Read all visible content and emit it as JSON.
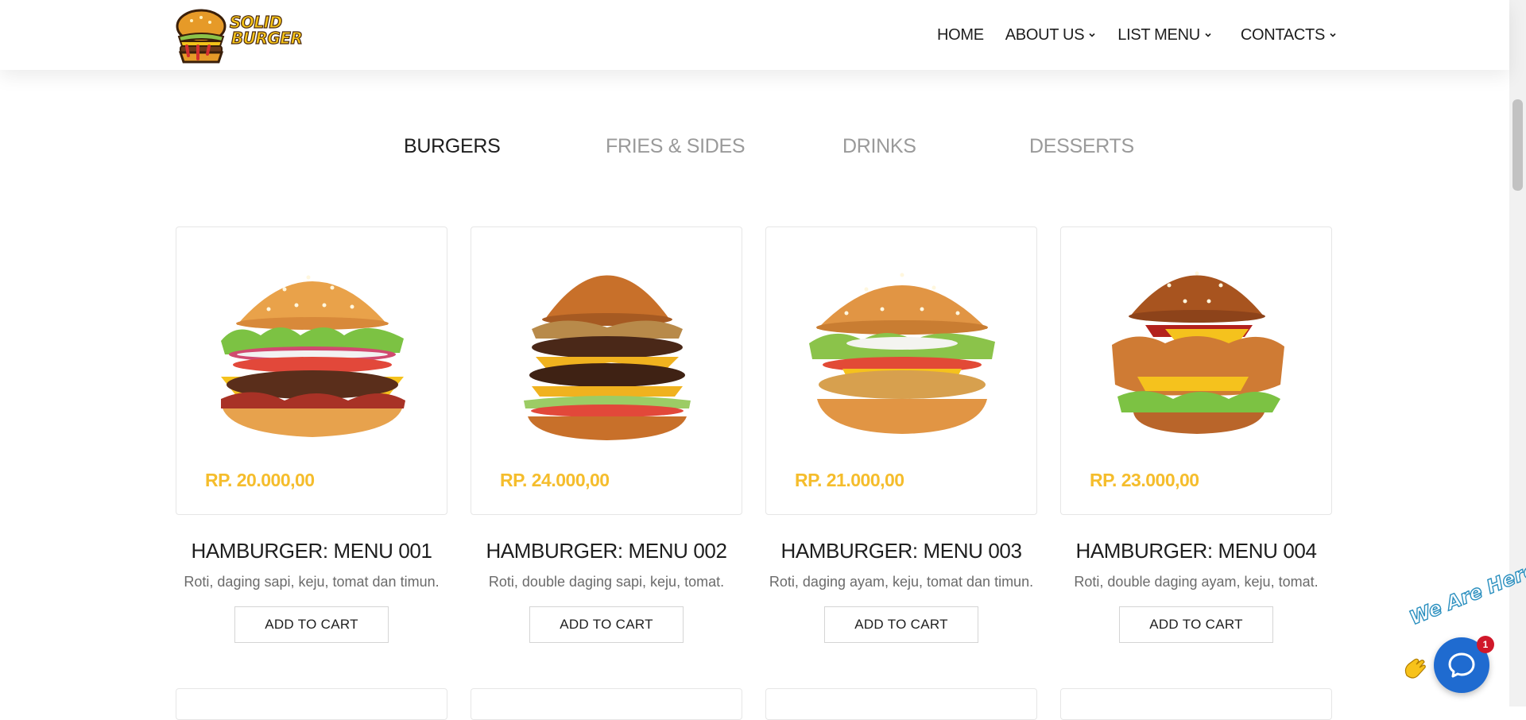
{
  "brand": {
    "line1": "SOLID",
    "line2": "BURGER"
  },
  "nav": {
    "items": [
      {
        "label": "HOME",
        "dropdown": false
      },
      {
        "label": "ABOUT US",
        "dropdown": true
      },
      {
        "label": "LIST MENU",
        "dropdown": true
      },
      {
        "label": "CONTACTS",
        "dropdown": true
      }
    ]
  },
  "tabs": {
    "items": [
      {
        "label": "BURGERS",
        "active": true
      },
      {
        "label": "FRIES & SIDES",
        "active": false
      },
      {
        "label": "DRINKS",
        "active": false
      },
      {
        "label": "DESSERTS",
        "active": false
      }
    ]
  },
  "products": [
    {
      "price": "RP. 20.000,00",
      "title": "HAMBURGER: MENU 001",
      "desc": "Roti, daging sapi, keju, tomat dan timun.",
      "button": "ADD TO CART"
    },
    {
      "price": "RP. 24.000,00",
      "title": "HAMBURGER: MENU 002",
      "desc": "Roti, double daging sapi, keju, tomat.",
      "button": "ADD TO CART"
    },
    {
      "price": "RP. 21.000,00",
      "title": "HAMBURGER: MENU 003",
      "desc": "Roti, daging ayam, keju, tomat dan timun.",
      "button": "ADD TO CART"
    },
    {
      "price": "RP. 23.000,00",
      "title": "HAMBURGER: MENU 004",
      "desc": "Roti, double daging ayam, keju, tomat.",
      "button": "ADD TO CART"
    }
  ],
  "chat": {
    "banner": "We Are Here!",
    "badge_count": "1"
  },
  "colors": {
    "accent_price": "#f5bd2c",
    "text_dark": "#1e1e1e",
    "tab_inactive": "#9a9a9a",
    "chat_blue": "#1f6bd0",
    "badge_red": "#d0182a"
  }
}
